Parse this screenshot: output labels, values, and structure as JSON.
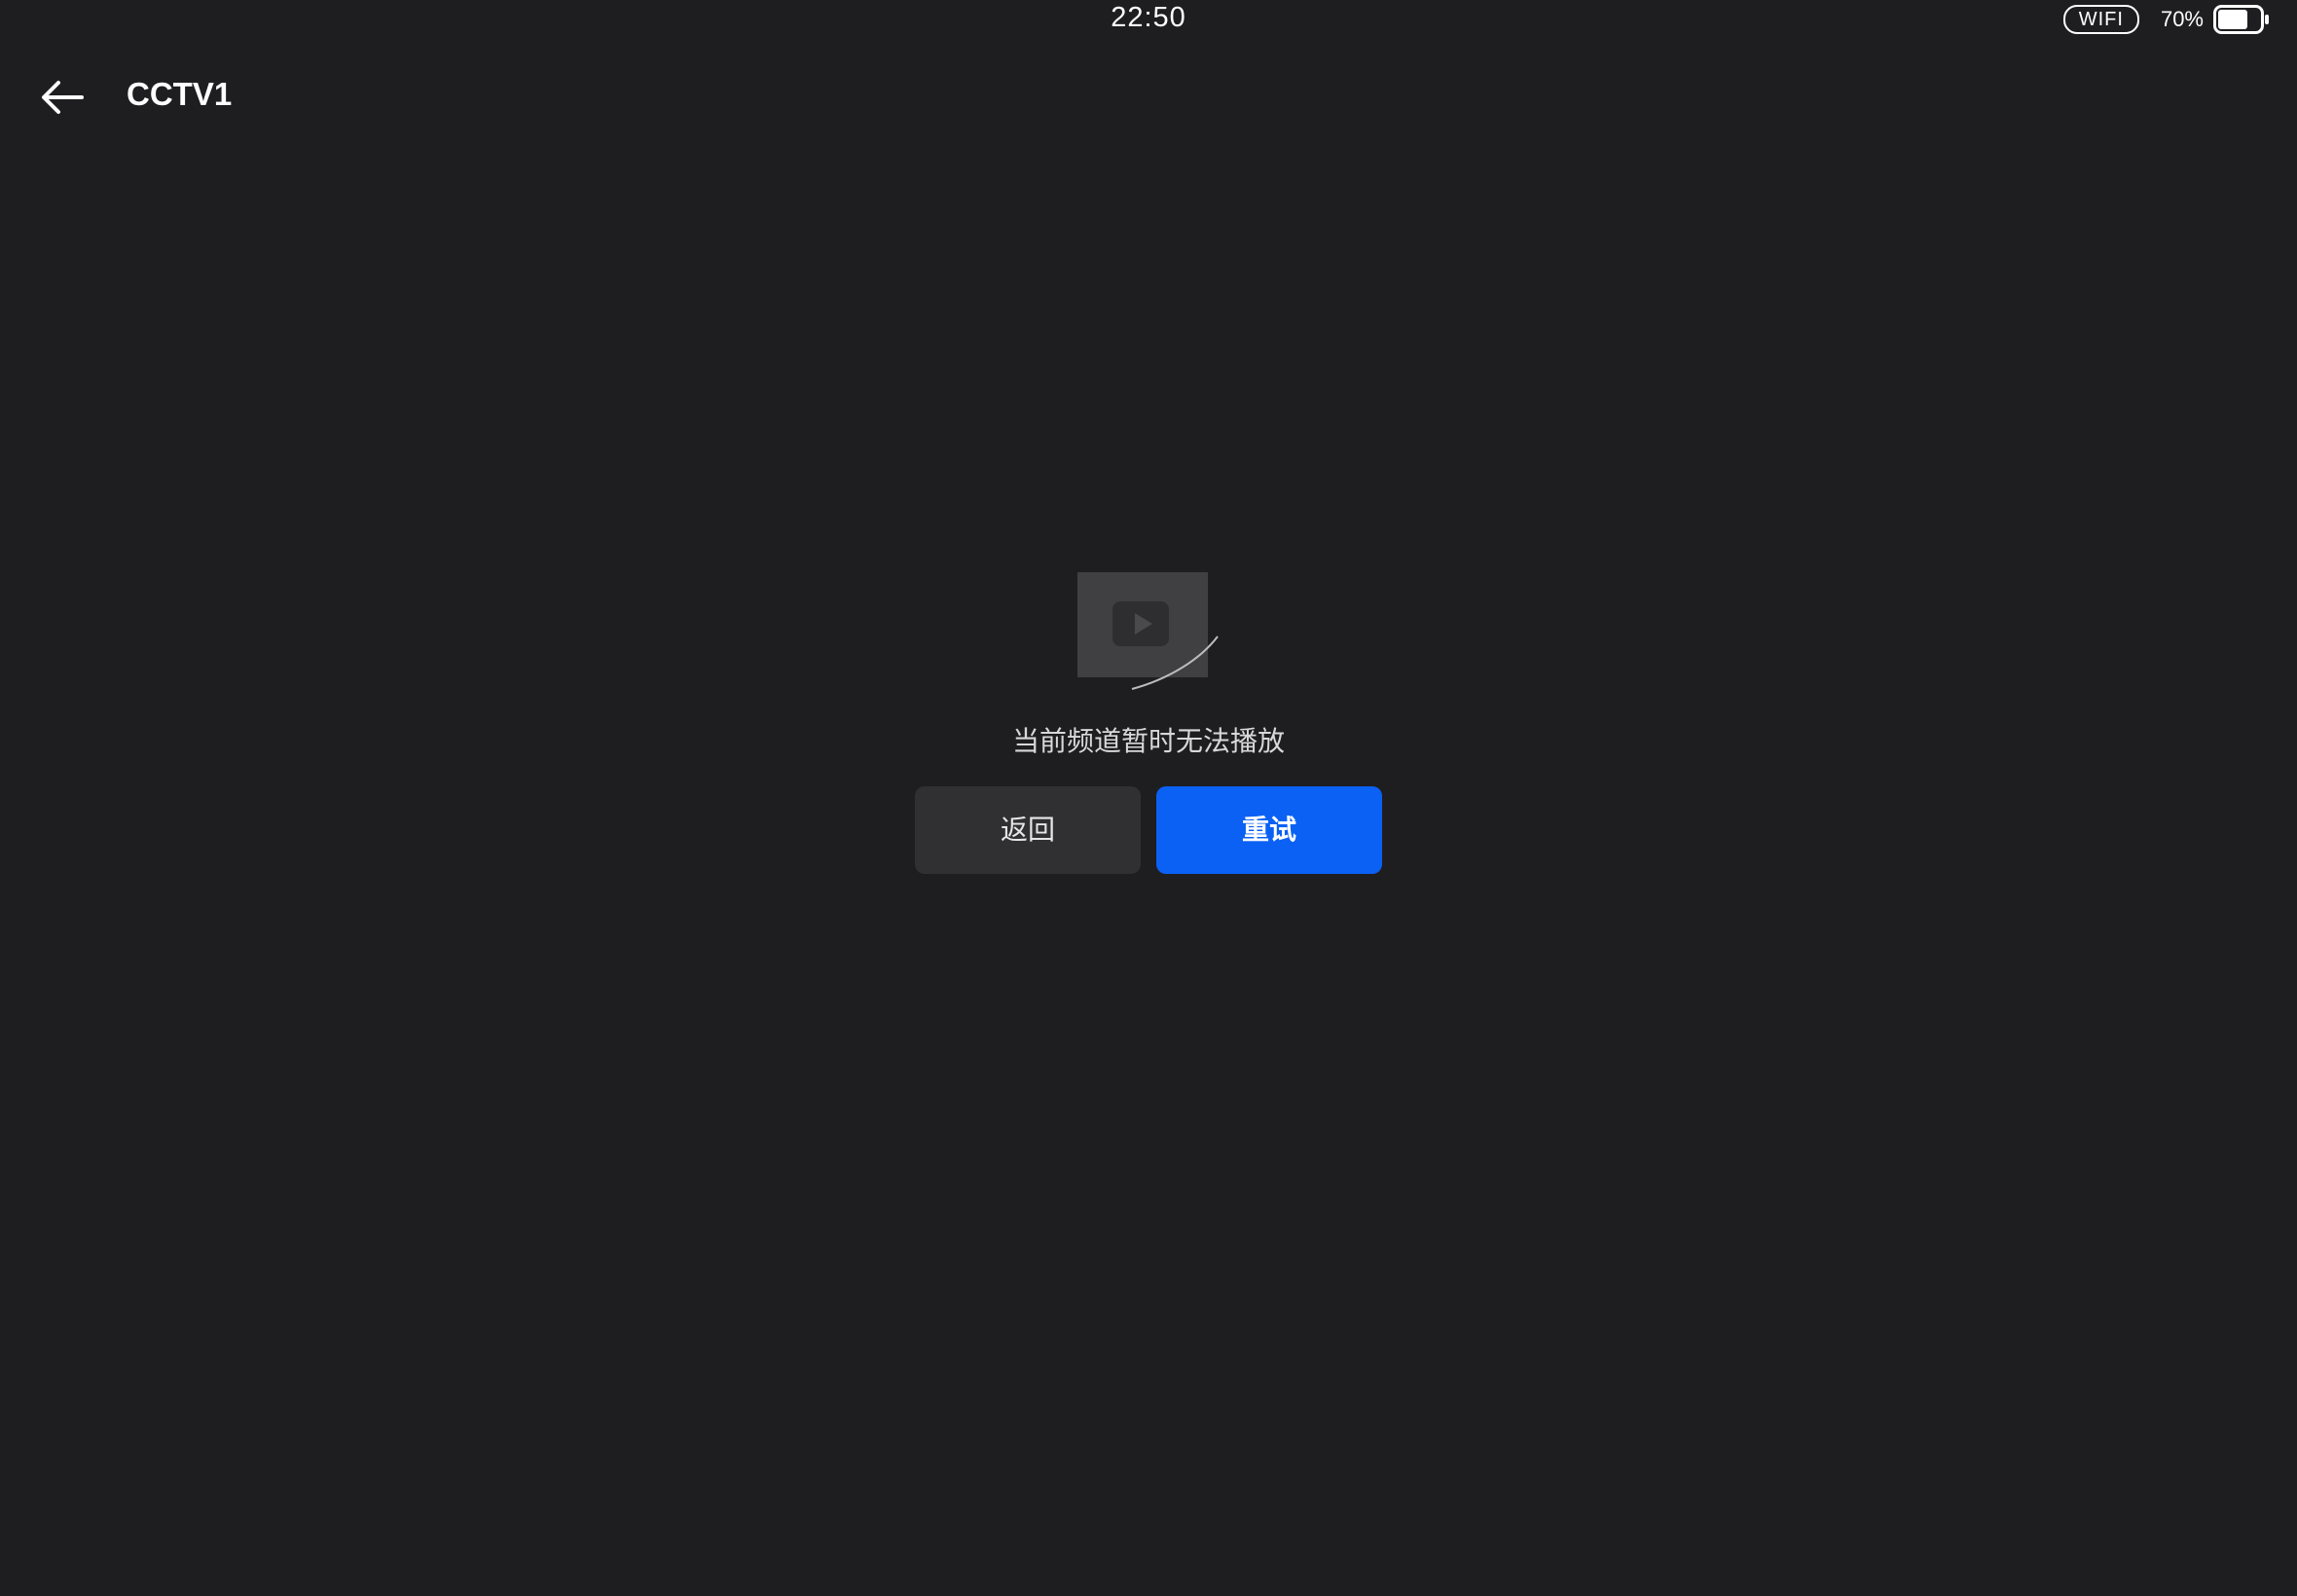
{
  "status_bar": {
    "time": "22:50",
    "wifi_label": "WIFI",
    "battery_percent": "70%",
    "battery_level": 0.7
  },
  "header": {
    "back_icon": "arrow-left-icon",
    "title": "CCTV1"
  },
  "error_state": {
    "illustration_icon": "video-play-icon",
    "message": "当前频道暂时无法播放",
    "back_button_label": "返回",
    "retry_button_label": "重试"
  },
  "colors": {
    "background": "#1e1e20",
    "primary_button": "#0b61f4",
    "secondary_button": "#303033"
  }
}
